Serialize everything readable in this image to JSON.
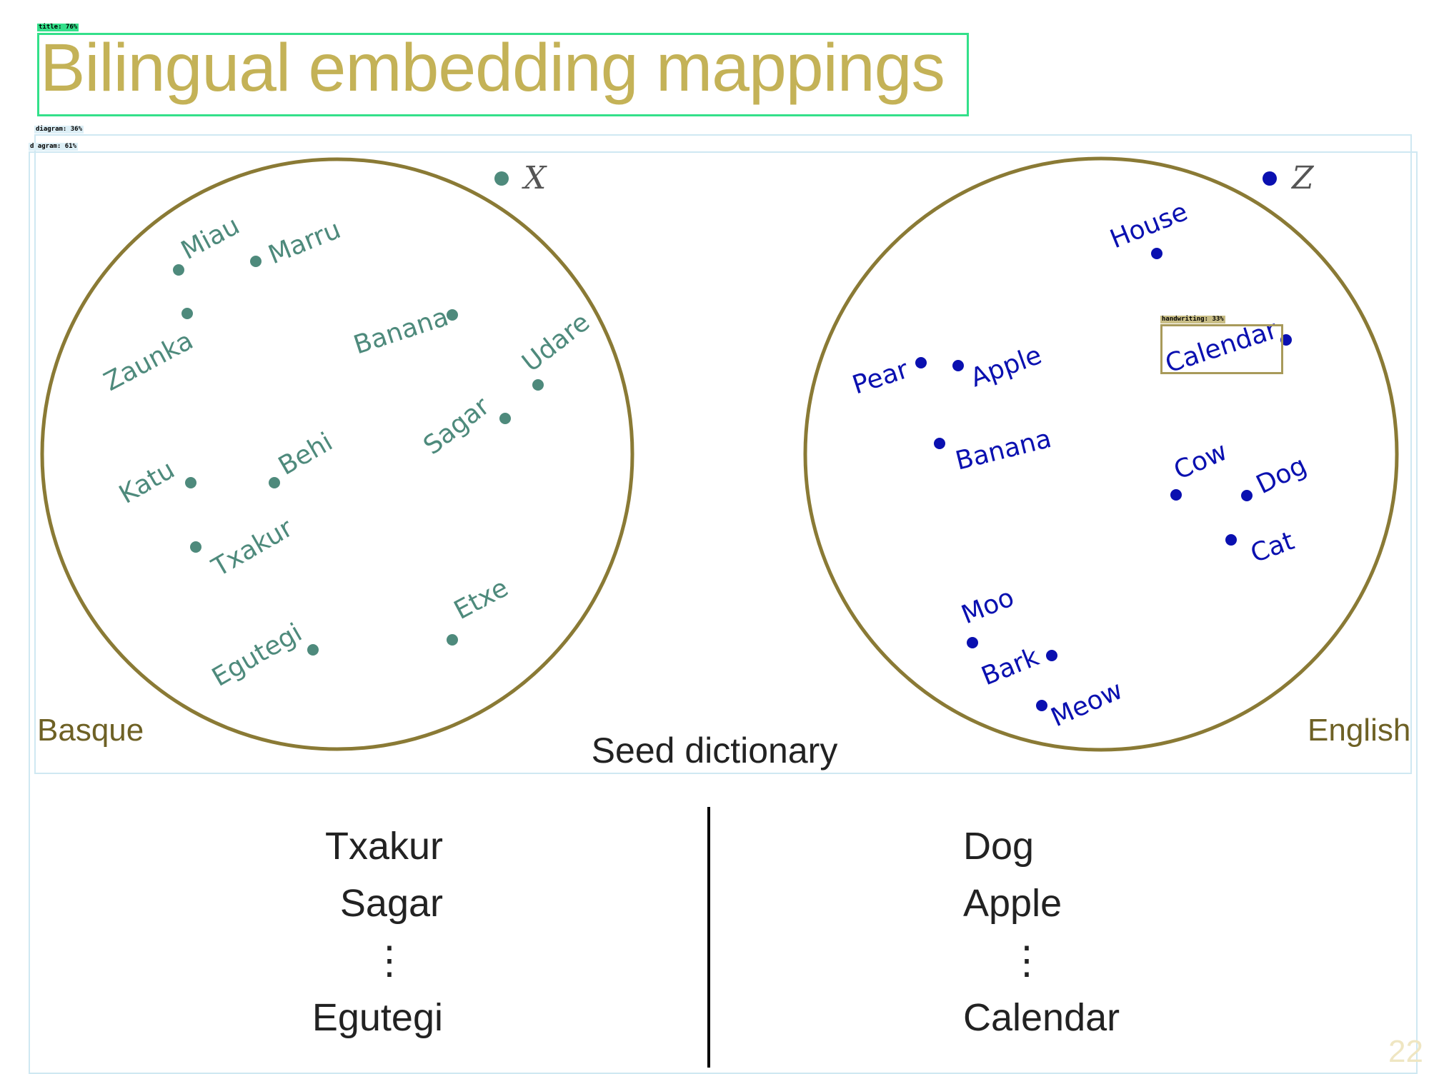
{
  "title": "Bilingual embedding mappings",
  "annotations": {
    "title_tag": "title: 76%",
    "diagram_tag": "diagram: 36%",
    "diagram2_tag": "d agram: 61%",
    "handwriting_tag": "handwriting: 33%"
  },
  "colors": {
    "title": "#C4B257",
    "circle": "#8A7A35",
    "basque_words": "#4E8A7C",
    "english_words": "#0A10B0",
    "lang_labels": "#6E6125"
  },
  "basque_space": {
    "label": "Basque",
    "symbol": "X",
    "words": [
      "Miau",
      "Marru",
      "Zaunka",
      "Banana",
      "Udare",
      "Sagar",
      "Katu",
      "Behi",
      "Txakur",
      "Etxe",
      "Egutegi"
    ]
  },
  "english_space": {
    "label": "English",
    "symbol": "Z",
    "words": [
      "House",
      "Calendar",
      "Pear",
      "Apple",
      "Banana",
      "Cow",
      "Dog",
      "Cat",
      "Moo",
      "Bark",
      "Meow"
    ]
  },
  "seed_dictionary": {
    "title": "Seed dictionary",
    "left": [
      "Txakur",
      "Sagar",
      "⋮",
      "Egutegi"
    ],
    "right": [
      "Dog",
      "Apple",
      "⋮",
      "Calendar"
    ]
  },
  "page_number": "22"
}
